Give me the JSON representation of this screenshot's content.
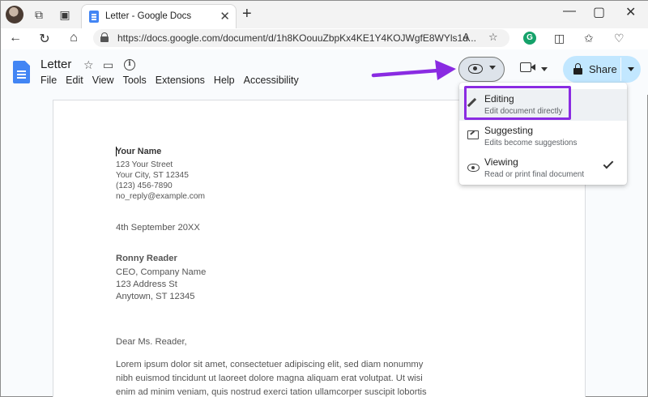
{
  "browser": {
    "tab_title": "Letter - Google Docs",
    "tab_close": "✕",
    "new_tab": "+",
    "url": "https://docs.google.com/document/d/1h8KOouuZbpKx4KE1Y4KOJWgfE8WYls1d...",
    "window_controls": [
      "—",
      "▢",
      "✕"
    ]
  },
  "docs": {
    "title": "Letter",
    "menu": [
      "File",
      "Edit",
      "View",
      "Tools",
      "Extensions",
      "Help",
      "Accessibility"
    ],
    "share_label": "Share"
  },
  "mode_menu": {
    "items": [
      {
        "title": "Editing",
        "desc": "Edit document directly"
      },
      {
        "title": "Suggesting",
        "desc": "Edits become suggestions"
      },
      {
        "title": "Viewing",
        "desc": "Read or print final document"
      }
    ],
    "checked": "Viewing"
  },
  "letter": {
    "sender_name": "Your Name",
    "street": "123 Your Street",
    "city": "Your City, ST 12345",
    "phone": "(123) 456-7890",
    "email": "no_reply@example.com",
    "date": "4th September 20XX",
    "recipient_name": "Ronny Reader",
    "recipient_title": "CEO, Company Name",
    "recipient_street": "123 Address St",
    "recipient_city": "Anytown, ST 12345",
    "salutation": "Dear Ms. Reader,",
    "body_lines": [
      "Lorem ipsum dolor sit amet, consectetuer adipiscing elit, sed diam nonummy",
      "nibh euismod tincidunt ut laoreet dolore magna aliquam erat volutpat. Ut wisi",
      "enim ad minim veniam, quis nostrud exerci tation ullamcorper suscipit lobortis"
    ]
  },
  "colors": {
    "accent_purple": "#8a2be2",
    "share_bg": "#c2e7ff",
    "docs_blue": "#4285f4"
  }
}
